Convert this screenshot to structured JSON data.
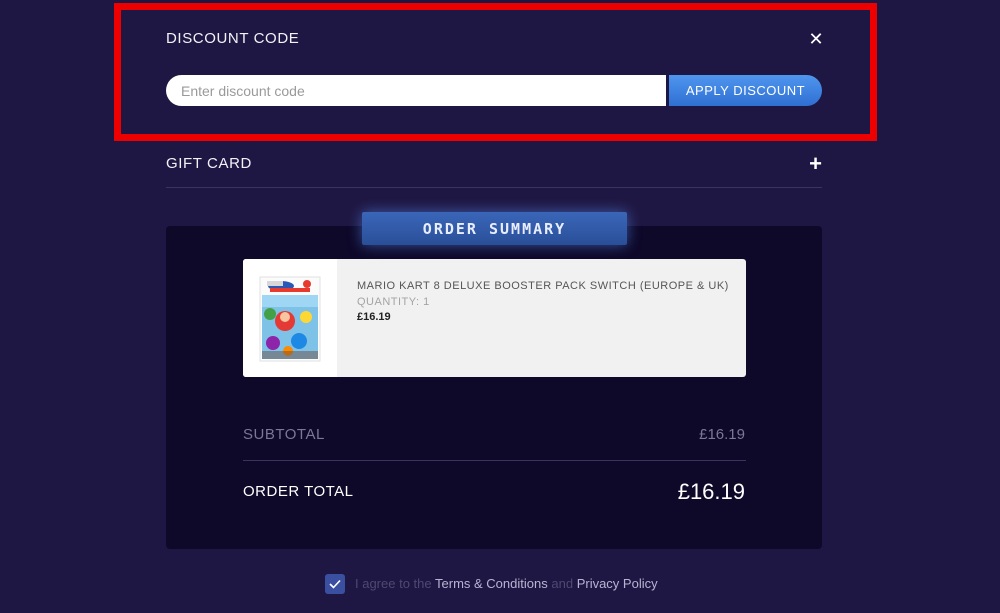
{
  "discount": {
    "title": "DISCOUNT CODE",
    "input_placeholder": "Enter discount code",
    "input_value": "",
    "apply_label": "APPLY DISCOUNT",
    "close_icon": "close-icon"
  },
  "gift_card": {
    "label": "GIFT CARD",
    "expand_icon": "plus-icon"
  },
  "order_summary": {
    "title": "ORDER SUMMARY",
    "items": [
      {
        "name": "MARIO KART 8 DELUXE BOOSTER PACK SWITCH (EUROPE & UK)",
        "quantity": "QUANTITY: 1",
        "price": "£16.19"
      }
    ],
    "subtotal_label": "SUBTOTAL",
    "subtotal_value": "£16.19",
    "total_label": "ORDER TOTAL",
    "total_value": "£16.19"
  },
  "agreement": {
    "prefix": "I agree to the",
    "terms_link": "Terms & Conditions",
    "conjunction": "and",
    "privacy_link": "Privacy Policy",
    "checked": true
  },
  "colors": {
    "background": "#1f1743",
    "panel": "#0e0829",
    "accent_button": "#3b7fe0",
    "highlight_border": "#ee0000"
  }
}
